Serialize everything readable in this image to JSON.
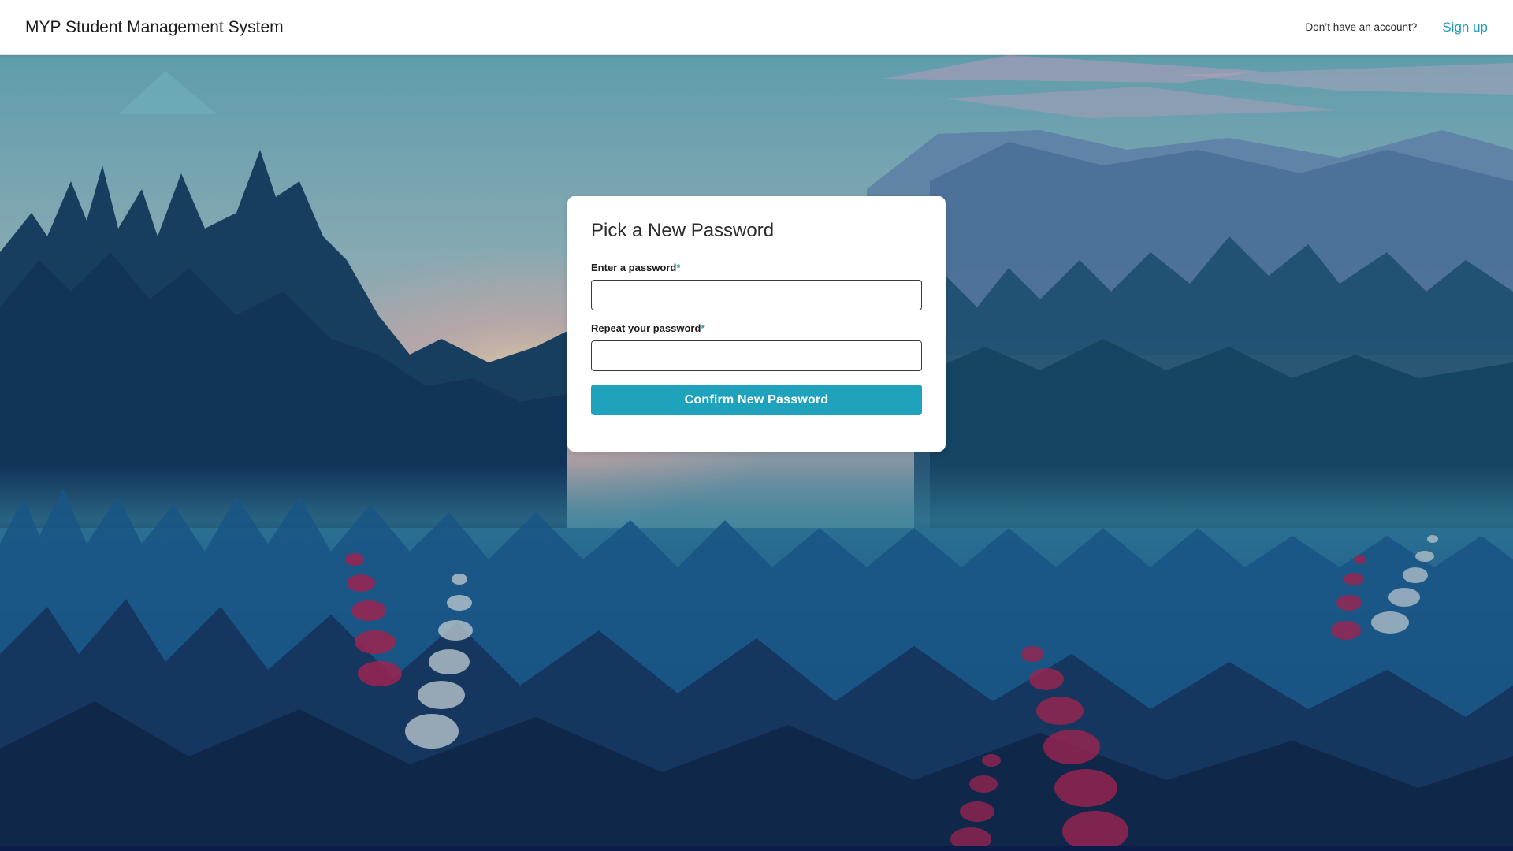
{
  "header": {
    "app_title": "MYP Student Management System",
    "no_account_text": "Don’t have an account?",
    "signup_label": "Sign up"
  },
  "form": {
    "title": "Pick a New Password",
    "password_label": "Enter a password",
    "repeat_label": "Repeat your password",
    "required_marker": "*",
    "password_value": "",
    "repeat_value": "",
    "submit_label": "Confirm New Password"
  },
  "colors": {
    "accent": "#1fa3bd",
    "link": "#1c9ab5"
  }
}
